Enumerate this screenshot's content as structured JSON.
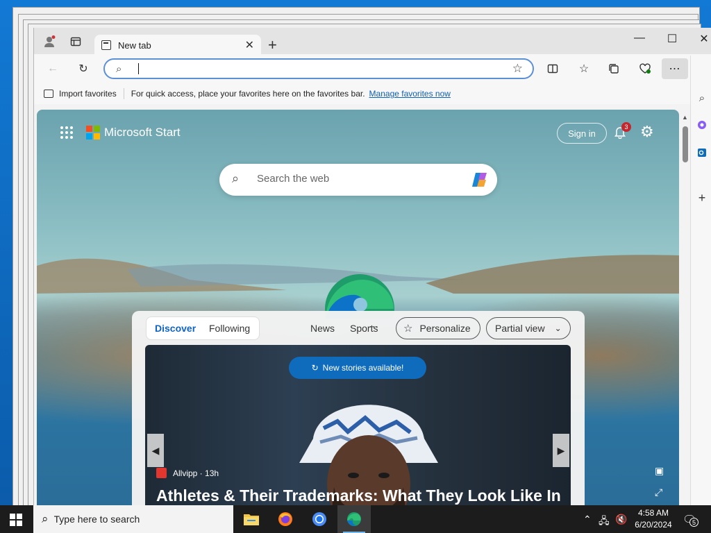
{
  "browser": {
    "tab_title": "New tab",
    "address_value": "",
    "favorites_bar": {
      "import_label": "Import favorites",
      "message": "For quick access, place your favorites here on the favorites bar.",
      "link": "Manage favorites now"
    },
    "more_label": "⋯"
  },
  "newtab": {
    "brand": "Microsoft Start",
    "sign_in": "Sign in",
    "notification_count": "3",
    "search_placeholder": "Search the web",
    "pivots": [
      "Discover",
      "Following"
    ],
    "tabs": [
      "News",
      "Sports"
    ],
    "more": "⋯",
    "personalize": "Personalize",
    "view_mode": "Partial view",
    "banner": "New stories available!",
    "article": {
      "source": "Allvipp · 13h",
      "headline": "Athletes & Their Trademarks: What They Look Like In"
    }
  },
  "taskbar": {
    "search_placeholder": "Type here to search",
    "time": "4:58 AM",
    "date": "6/20/2024",
    "notif_count": "5"
  },
  "colors": {
    "accent": "#0f6cbd",
    "taskbar": "#1c1c1c",
    "badge": "#c4262e"
  }
}
